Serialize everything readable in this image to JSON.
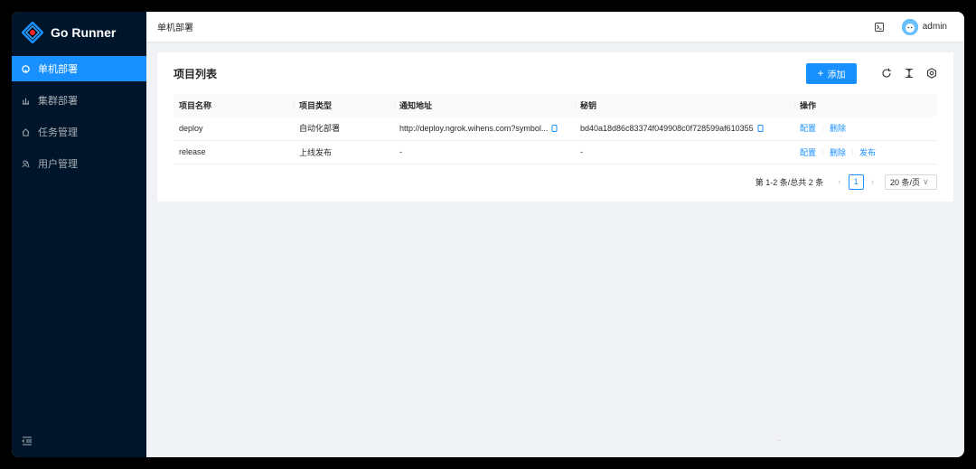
{
  "app": {
    "name": "Go Runner"
  },
  "sidebar": {
    "items": [
      {
        "label": "单机部署",
        "icon": "github-icon",
        "active": true
      },
      {
        "label": "集群部署",
        "icon": "cluster-icon",
        "active": false
      },
      {
        "label": "任务管理",
        "icon": "home-icon",
        "active": false
      },
      {
        "label": "用户管理",
        "icon": "user-icon",
        "active": false
      }
    ]
  },
  "header": {
    "breadcrumb": "单机部署",
    "user": "admin"
  },
  "card": {
    "title": "项目列表",
    "add_label": "添加",
    "columns": [
      "项目名称",
      "项目类型",
      "通知地址",
      "秘钥",
      "操作"
    ],
    "rows": [
      {
        "name": "deploy",
        "type": "自动化部署",
        "url": "http://deploy.ngrok.wihens.com?symbol...",
        "secret": "bd40a18d86c83374f049908c0f728599af610355",
        "actions": [
          "配置",
          "删除"
        ]
      },
      {
        "name": "release",
        "type": "上线发布",
        "url": "-",
        "secret": "-",
        "actions": [
          "配置",
          "删除",
          "发布"
        ]
      }
    ]
  },
  "pagination": {
    "total_text": "第 1-2 条/总共 2 条",
    "current": "1",
    "page_size": "20 条/页"
  },
  "colors": {
    "primary": "#1890ff",
    "sider": "#001529"
  }
}
